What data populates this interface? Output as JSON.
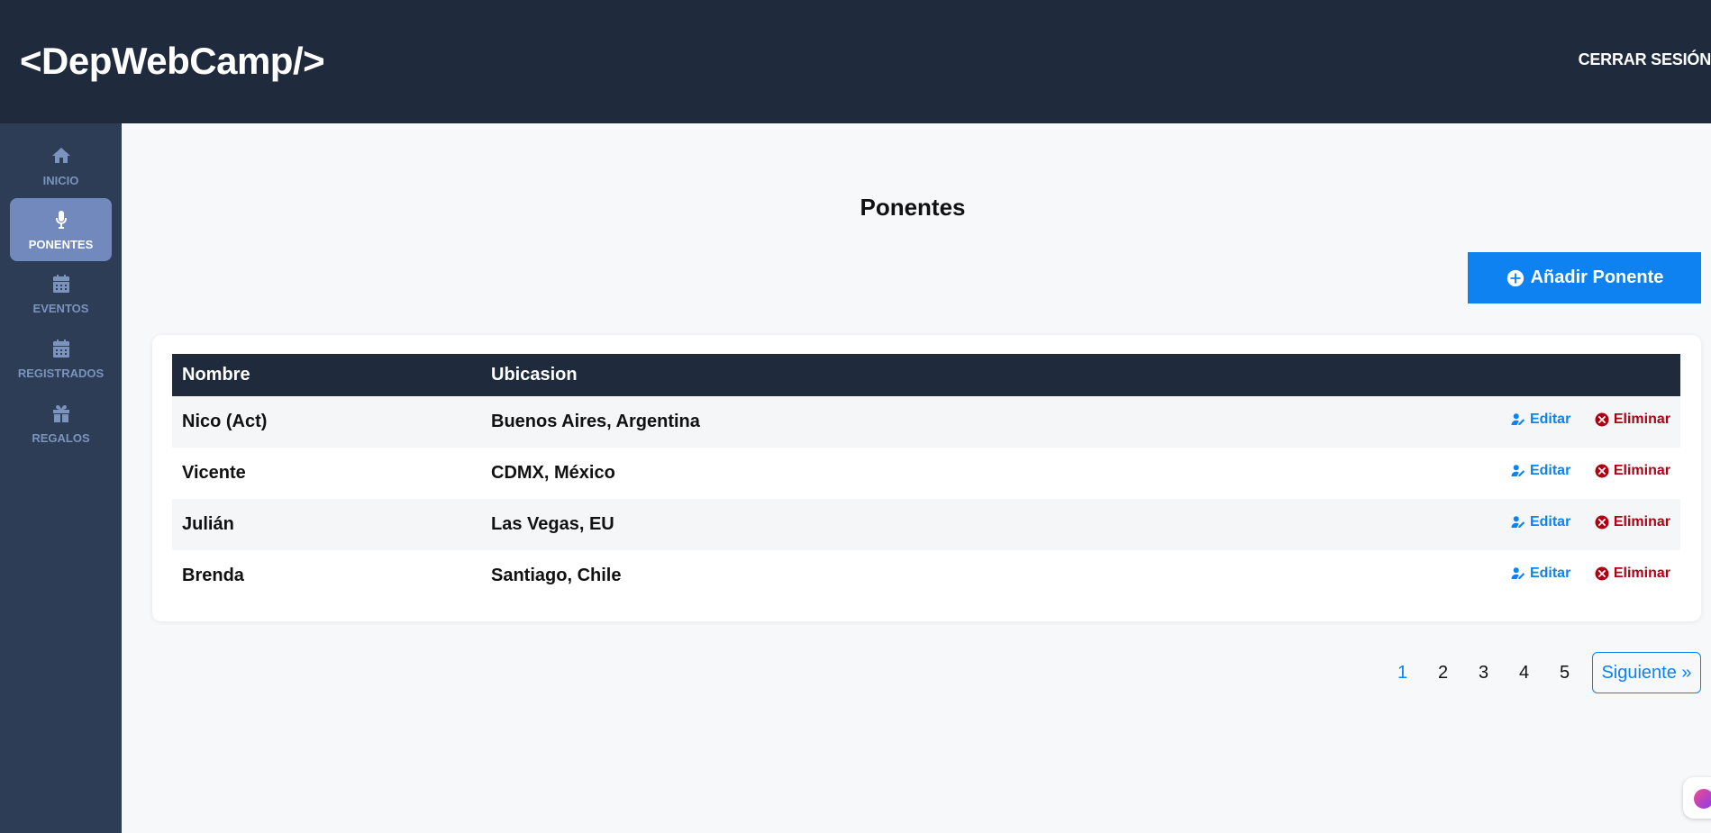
{
  "header": {
    "logo": "<DepWebCamp/>",
    "logout_label": "CERRAR SESIÓN"
  },
  "sidebar": {
    "items": [
      {
        "label": "INICIO",
        "icon": "home-icon",
        "active": false
      },
      {
        "label": "PONENTES",
        "icon": "microphone-icon",
        "active": true
      },
      {
        "label": "EVENTOS",
        "icon": "calendar-icon",
        "active": false
      },
      {
        "label": "REGISTRADOS",
        "icon": "calendar-icon",
        "active": false
      },
      {
        "label": "REGALOS",
        "icon": "gift-icon",
        "active": false
      }
    ]
  },
  "main": {
    "title": "Ponentes",
    "add_button_label": "Añadir Ponente",
    "table": {
      "columns": [
        "Nombre",
        "Ubicasion"
      ],
      "rows": [
        {
          "name": "Nico (Act)",
          "location": "Buenos Aires, Argentina"
        },
        {
          "name": "Vicente",
          "location": "CDMX, México"
        },
        {
          "name": "Julián",
          "location": "Las Vegas, EU"
        },
        {
          "name": "Brenda",
          "location": "Santiago, Chile"
        }
      ],
      "edit_label": "Editar",
      "delete_label": "Eliminar"
    },
    "pagination": {
      "pages": [
        "1",
        "2",
        "3",
        "4",
        "5"
      ],
      "current": "1",
      "next_label": "Siguiente »"
    }
  },
  "colors": {
    "header_bg": "#1f2a3c",
    "sidebar_bg": "#2d3d56",
    "sidebar_active": "#7189bc",
    "accent": "#0d82f0",
    "danger": "#b00014"
  }
}
